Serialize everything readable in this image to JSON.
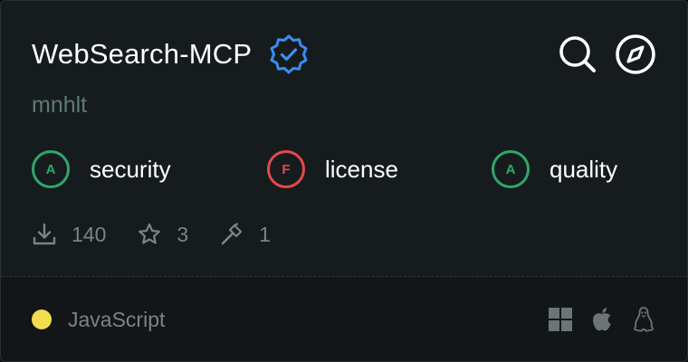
{
  "card": {
    "title": "WebSearch-MCP",
    "verified_icon": "verified-badge-icon",
    "author": "mnhlt",
    "actions": [
      {
        "icon": "search-icon"
      },
      {
        "icon": "compass-icon"
      }
    ],
    "grades": [
      {
        "grade": "A",
        "label": "security",
        "status": "pass"
      },
      {
        "grade": "F",
        "label": "license",
        "status": "fail"
      },
      {
        "grade": "A",
        "label": "quality",
        "status": "pass"
      }
    ],
    "stats": {
      "downloads": "140",
      "stars": "3",
      "tools": "1"
    },
    "footer": {
      "language": "JavaScript",
      "language_color": "#f2dd4f",
      "platforms": [
        "windows-icon",
        "apple-icon",
        "linux-icon"
      ]
    }
  },
  "colors": {
    "background": "#161b1d",
    "verified": "#3b8ef0",
    "pass": "#2ea86a",
    "fail": "#e5484d",
    "muted": "#7b8386",
    "author": "#5e7a75"
  }
}
